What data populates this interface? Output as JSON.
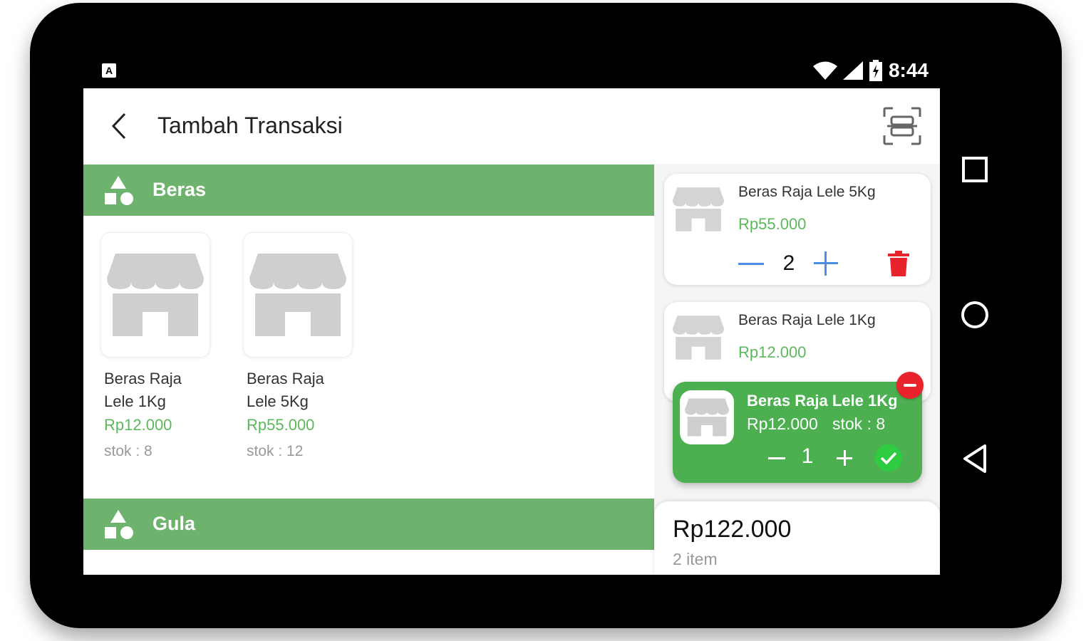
{
  "status_bar": {
    "time": "8:44",
    "notification_icon": "A"
  },
  "app_bar": {
    "title": "Tambah Transaksi"
  },
  "categories": [
    {
      "name": "Beras",
      "products": [
        {
          "name_line1": "Beras Raja",
          "name_line2": "Lele 1Kg",
          "price": "Rp12.000",
          "stock": "stok : 8"
        },
        {
          "name_line1": "Beras Raja",
          "name_line2": "Lele 5Kg",
          "price": "Rp55.000",
          "stock": "stok : 12"
        }
      ]
    },
    {
      "name": "Gula",
      "products": []
    }
  ],
  "cart": {
    "items": [
      {
        "name": "Beras Raja Lele 5Kg",
        "price": "Rp55.000",
        "qty": "2"
      },
      {
        "name": "Beras Raja Lele 1Kg",
        "price": "Rp12.000",
        "qty": ""
      }
    ],
    "popup": {
      "name": "Beras Raja Lele 1Kg",
      "price": "Rp12.000",
      "stock": "stok : 8",
      "qty": "1"
    },
    "total": "Rp122.000",
    "count": "2 item"
  },
  "colors": {
    "accent": "#4caf50",
    "category_bar": "#6db36e",
    "price": "#5cb85c",
    "delete": "#e8232b",
    "qty_controls": "#4a90e2"
  },
  "icons": [
    "back-arrow-icon",
    "barcode-scan-icon",
    "category-shapes-icon",
    "store-icon",
    "trash-icon",
    "check-icon",
    "remove-icon",
    "wifi-icon",
    "signal-icon",
    "battery-icon"
  ]
}
